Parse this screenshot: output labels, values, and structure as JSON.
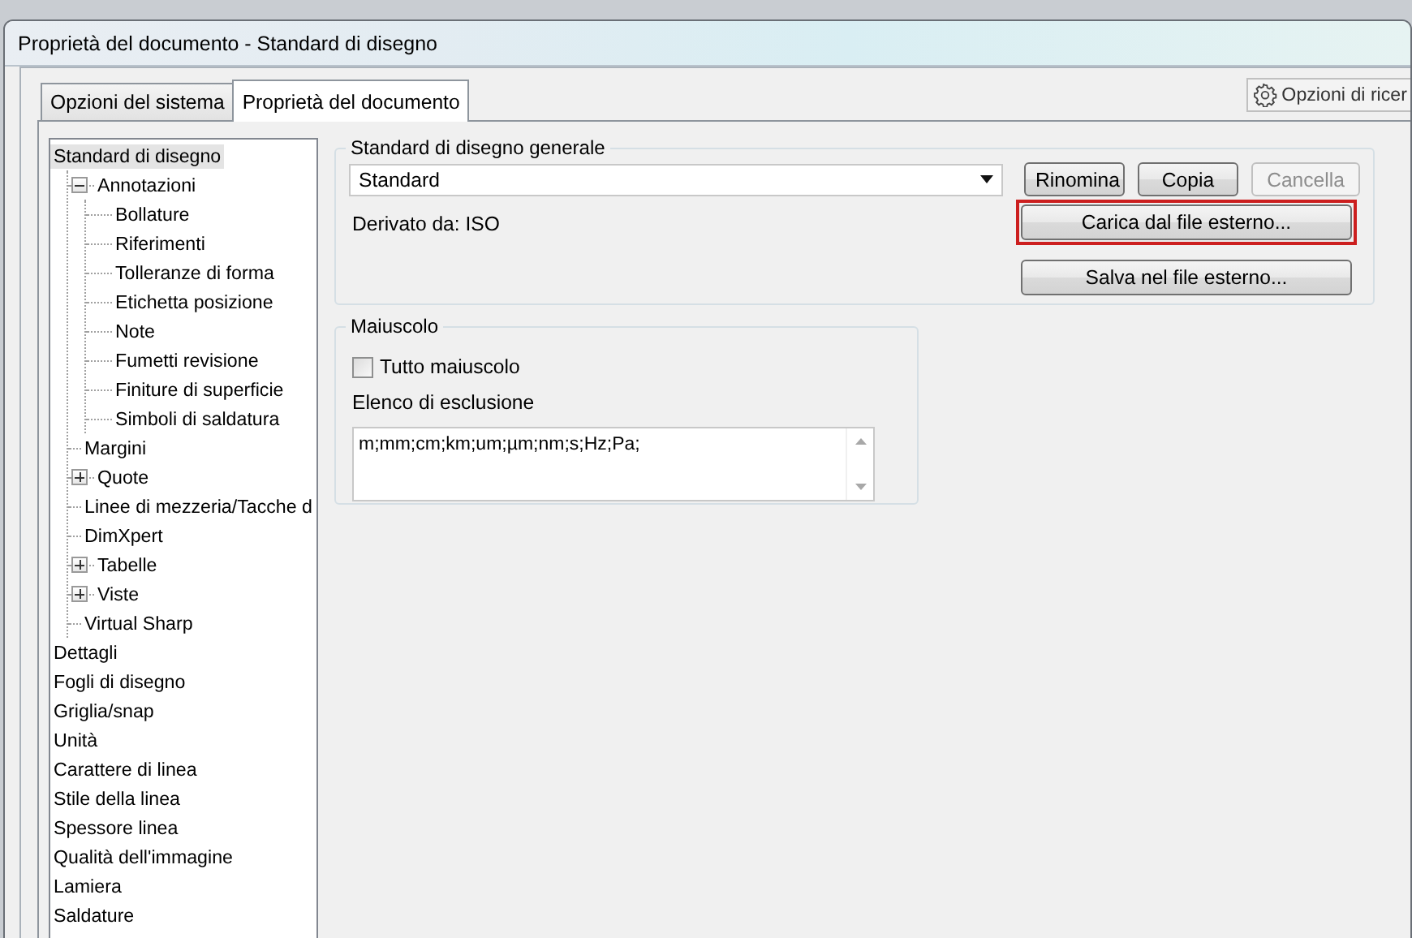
{
  "window": {
    "title": "Proprietà del documento - Standard di disegno"
  },
  "tabs": [
    {
      "label": "Opzioni del sistema",
      "selected": false
    },
    {
      "label": "Proprietà del documento",
      "selected": true
    }
  ],
  "search_options_button": {
    "label": "Opzioni di ricer"
  },
  "tree": [
    {
      "label": "Standard di disegno",
      "selected": true,
      "children": [
        {
          "label": "Annotazioni",
          "expanded": true,
          "children": [
            {
              "label": "Bollature"
            },
            {
              "label": "Riferimenti"
            },
            {
              "label": "Tolleranze di forma"
            },
            {
              "label": "Etichetta posizione"
            },
            {
              "label": "Note"
            },
            {
              "label": "Fumetti revisione"
            },
            {
              "label": "Finiture di superficie"
            },
            {
              "label": "Simboli di saldatura"
            }
          ]
        },
        {
          "label": "Margini"
        },
        {
          "label": "Quote",
          "expanded": false
        },
        {
          "label": "Linee di mezzeria/Tacche d"
        },
        {
          "label": "DimXpert"
        },
        {
          "label": "Tabelle",
          "expanded": false
        },
        {
          "label": "Viste",
          "expanded": false
        },
        {
          "label": "Virtual Sharp"
        }
      ]
    },
    {
      "label": "Dettagli"
    },
    {
      "label": "Fogli di disegno"
    },
    {
      "label": "Griglia/snap"
    },
    {
      "label": "Unità"
    },
    {
      "label": "Carattere di linea"
    },
    {
      "label": "Stile della linea"
    },
    {
      "label": "Spessore linea"
    },
    {
      "label": "Qualità dell'immagine"
    },
    {
      "label": "Lamiera"
    },
    {
      "label": "Saldature"
    }
  ],
  "general_standard": {
    "title": "Standard di disegno generale",
    "value": "Standard",
    "derived_from": "Derivato da: ISO",
    "buttons": [
      {
        "label": "Rinomina",
        "disabled": false
      },
      {
        "label": "Copia",
        "disabled": false
      },
      {
        "label": "Cancella",
        "disabled": true
      }
    ],
    "file_buttons": [
      {
        "label": "Carica dal file esterno...",
        "highlighted": true
      },
      {
        "label": "Salva nel file esterno...",
        "highlighted": false
      }
    ]
  },
  "uppercase": {
    "title": "Maiuscolo",
    "checkbox": {
      "label": "Tutto maiuscolo",
      "checked": false
    },
    "exclusion_label": "Elenco di esclusione",
    "exclusion_value": "m;mm;cm;km;um;µm;nm;s;Hz;Pa;"
  }
}
